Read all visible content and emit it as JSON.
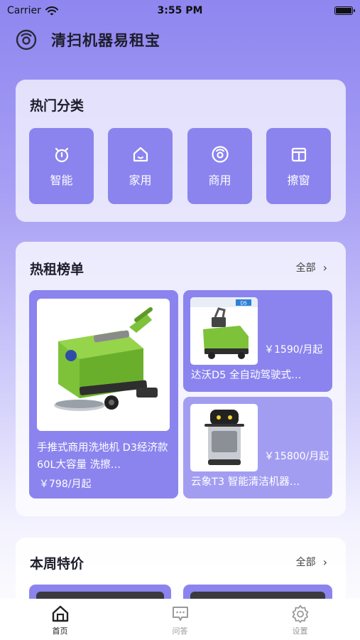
{
  "status_bar": {
    "carrier": "Carrier",
    "time": "3:55 PM"
  },
  "header": {
    "title": "清扫机器易租宝",
    "logo_icon": "robot-vacuum-icon"
  },
  "categories": {
    "title": "热门分类",
    "items": [
      {
        "label": "智能",
        "icon": "timer-icon"
      },
      {
        "label": "家用",
        "icon": "home-icon"
      },
      {
        "label": "商用",
        "icon": "robot-vacuum-icon"
      },
      {
        "label": "擦窗",
        "icon": "window-icon"
      }
    ]
  },
  "hot_rent": {
    "title": "热租榜单",
    "see_all": "全部",
    "featured": {
      "name": "手推式商用洗地机 D3经济款 60L大容量 洗擦…",
      "price": "￥798",
      "price_unit": "/月起"
    },
    "items": [
      {
        "name": "达沃D5 全自动驾驶式…",
        "price": "￥1590",
        "price_unit": "/月起",
        "badge": "D5"
      },
      {
        "name": "云象T3 智能清洁机器…",
        "price": "￥15800",
        "price_unit": "/月起"
      }
    ]
  },
  "weekly": {
    "title": "本周特价",
    "see_all": "全部"
  },
  "tab_bar": {
    "items": [
      {
        "label": "首页",
        "icon": "home-icon",
        "active": true
      },
      {
        "label": "问答",
        "icon": "chat-icon",
        "active": false
      },
      {
        "label": "设置",
        "icon": "gear-icon",
        "active": false
      }
    ]
  },
  "colors": {
    "accent": "#8b84ee",
    "background_top": "#8f86f0"
  }
}
